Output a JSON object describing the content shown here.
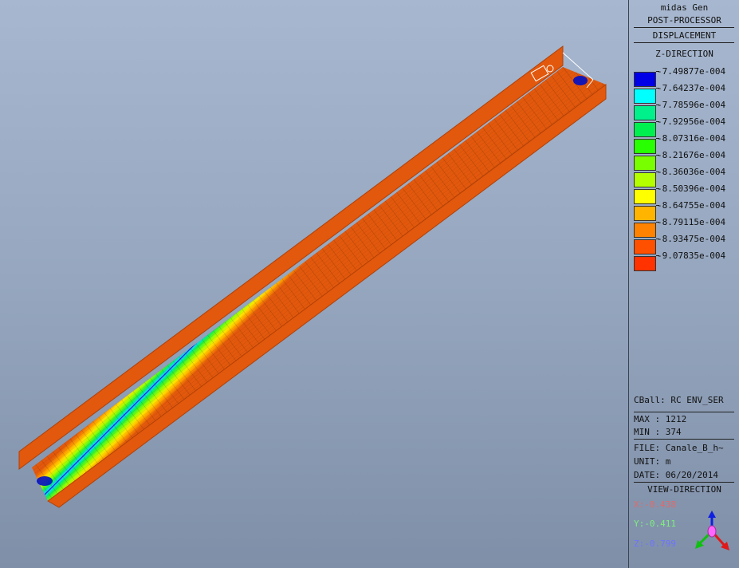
{
  "header": {
    "app": "midas Gen",
    "mode": "POST-PROCESSOR",
    "result": "DISPLACEMENT",
    "direction": "Z-DIRECTION"
  },
  "legend": [
    {
      "value": "-7.49877e-004",
      "color": "#0000e6"
    },
    {
      "value": "-7.64237e-004",
      "color": "#00ffff"
    },
    {
      "value": "-7.78596e-004",
      "color": "#00f08c"
    },
    {
      "value": "-7.92956e-004",
      "color": "#00f050"
    },
    {
      "value": "-8.07316e-004",
      "color": "#28ff00"
    },
    {
      "value": "-8.21676e-004",
      "color": "#78ff00"
    },
    {
      "value": "-8.36036e-004",
      "color": "#b4ff00"
    },
    {
      "value": "-8.50396e-004",
      "color": "#ffff00"
    },
    {
      "value": "-8.64755e-004",
      "color": "#ffb400"
    },
    {
      "value": "-8.79115e-004",
      "color": "#ff8200"
    },
    {
      "value": "-8.93475e-004",
      "color": "#ff5000"
    },
    {
      "value": "-9.07835e-004",
      "color": "#ff3200"
    }
  ],
  "info": {
    "cball": "CBall: RC ENV_SER",
    "max": "MAX : 1212",
    "min": "MIN : 374",
    "file": "FILE: Canale_B_h~",
    "unit": "UNIT: m",
    "date": "DATE: 06/20/2014",
    "view_title": "VIEW-DIRECTION",
    "x": "X:-0.438",
    "y": "Y:-0.411",
    "z": "Z:-0.799"
  },
  "colors": {
    "wall": "#e2580c",
    "axis_x": "#e06a6a",
    "axis_y": "#7cf07c",
    "axis_z": "#6c74ff"
  }
}
